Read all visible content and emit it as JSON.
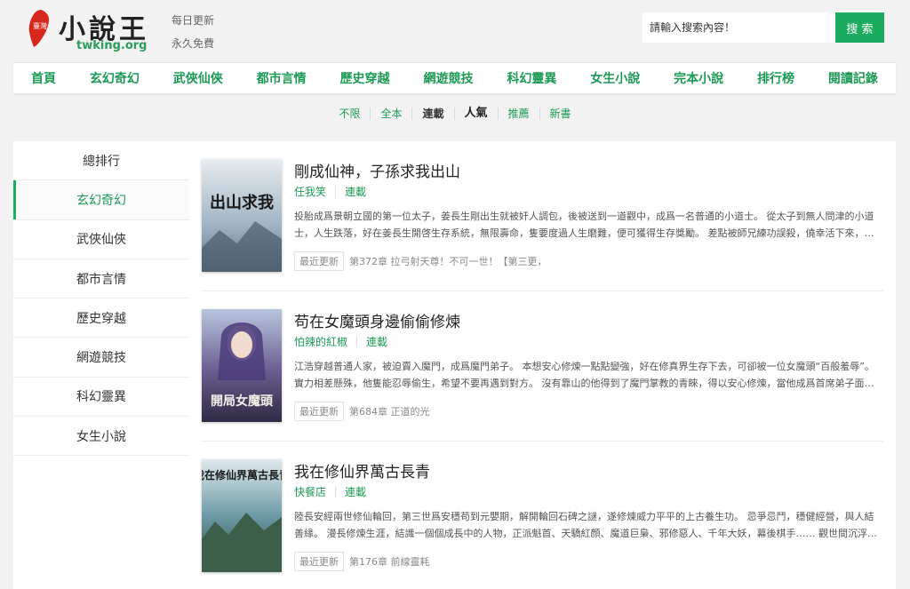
{
  "header": {
    "logo_badge": "臺灣",
    "logo_title": "小說王",
    "logo_domain": "twking.org",
    "slogan_1": "每日更新",
    "slogan_2": "永久免費"
  },
  "search": {
    "placeholder": "請輸入搜索內容！",
    "button_label": "搜 索"
  },
  "nav": {
    "items": [
      "首頁",
      "玄幻奇幻",
      "武俠仙俠",
      "都市言情",
      "歷史穿越",
      "網遊競技",
      "科幻靈異",
      "女生小說",
      "完本小說",
      "排行榜",
      "閱讀記錄"
    ]
  },
  "filters": {
    "items": [
      "不限",
      "全本",
      "連載",
      "人氣",
      "推薦",
      "新書"
    ]
  },
  "sidebar": {
    "items": [
      "總排行",
      "玄幻奇幻",
      "武俠仙俠",
      "都市言情",
      "歷史穿越",
      "網遊競技",
      "科幻靈異",
      "女生小說"
    ]
  },
  "books": [
    {
      "title": "剛成仙神，子孫求我出山",
      "author": "任我笑",
      "status": "連載",
      "description": "投胎成爲景朝立國的第一位太子，姜長生剛出生就被奸人調包，後被送到一道觀中，成爲一名普通的小道士。 從太子到無人問津的小道士，人生跌落，好在姜長生開啓生存系統，無限壽命，隻要度過人生磨難，便可獲得生存獎勵。 差點被師兄練功誤殺，僥幸活下來，…",
      "latest_label": "最近更新",
      "latest_chapter": "第372章 拉弓射天尊！不可一世！【第三更，",
      "cover_text": "出山求我",
      "cover_colors": [
        "#e8ecef",
        "#9db3c4",
        "#5a6e7f"
      ]
    },
    {
      "title": "苟在女魔頭身邊偷偷修煉",
      "author": "怕辣的紅椒",
      "status": "連載",
      "description": "江浩穿越普通人家，被迫賣入魔門，成爲魔門弟子。 本想安心修煉一點點變強，好在修真界生存下去，可卻被一位女魔頭“百般羞辱”。 實力相差懸殊，他隻能忍辱偷生，希望不要再遇到對方。 沒有靠山的他得到了魔門掌教的青睞，得以安心修煉，當他成爲首席弟子面…",
      "latest_label": "最近更新",
      "latest_chapter": "第684章 正道的光",
      "cover_text": "開局女魔頭",
      "cover_colors": [
        "#b9c6e0",
        "#6a5d8f",
        "#2f2a44"
      ]
    },
    {
      "title": "我在修仙界萬古長青",
      "author": "快餐店",
      "status": "連載",
      "description": "陸長安經兩世修仙輪回，第三世爲安穩苟到元嬰期，解開輪回石碑之謎，遂修煉威力平平的上古養生功。 忌爭忌鬥，穩健經營，與人結善緣。 漫長修煉生涯，結識一個個成長中的人物，正派魁首、天驕紅顔、魔道巨梟、邪修惡人、千年大妖，幕後棋手…… 觀世間沉浮…",
      "latest_label": "最近更新",
      "latest_chapter": "第176章 前線靈耗",
      "cover_text": "我在修仙界萬古長青",
      "cover_colors": [
        "#dfe9ee",
        "#6d9aa6",
        "#2e4a3a"
      ]
    }
  ],
  "colors": {
    "accent": "#1cac5f",
    "link": "#1d9a55",
    "background": "#f2f2f2"
  }
}
